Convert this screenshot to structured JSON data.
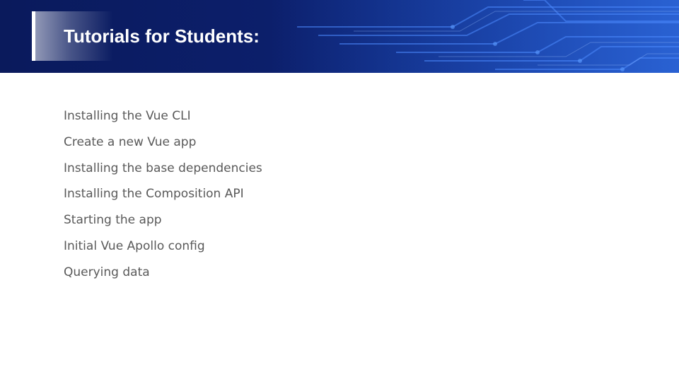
{
  "slide": {
    "title": "Tutorials for Students:",
    "topics": [
      "Installing the Vue CLI",
      "Create a new Vue app",
      "Installing the base dependencies",
      "Installing the Composition API",
      "Starting the app",
      "Initial Vue Apollo config",
      "Querying data"
    ]
  },
  "colors": {
    "header_dark": "#0a1a5c",
    "header_light": "#1646b8",
    "circuit_accent": "#3a78e8",
    "title_text": "#ffffff",
    "body_text": "#595959",
    "background": "#ffffff"
  }
}
